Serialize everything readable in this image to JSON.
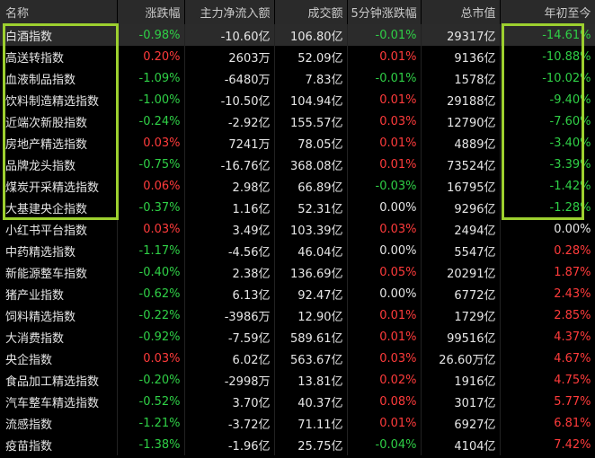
{
  "columns": [
    "名称",
    "涨跌幅",
    "主力净流入额",
    "成交额",
    "5分钟涨跌幅",
    "总市值",
    "年初至今"
  ],
  "rows": [
    {
      "name": "白酒指数",
      "chg": "-0.98%",
      "flow": "-10.60亿",
      "turnover": "106.80亿",
      "chg5": "-0.01%",
      "cap": "29317亿",
      "ytd": "-14.61%"
    },
    {
      "name": "高送转指数",
      "chg": "0.20%",
      "flow": "2603万",
      "turnover": "52.09亿",
      "chg5": "0.01%",
      "cap": "9136亿",
      "ytd": "-10.88%"
    },
    {
      "name": "血液制品指数",
      "chg": "-1.09%",
      "flow": "-6480万",
      "turnover": "7.83亿",
      "chg5": "-0.01%",
      "cap": "1578亿",
      "ytd": "-10.02%"
    },
    {
      "name": "饮料制造精选指数",
      "chg": "-1.00%",
      "flow": "-10.50亿",
      "turnover": "104.94亿",
      "chg5": "0.01%",
      "cap": "29188亿",
      "ytd": "-9.40%"
    },
    {
      "name": "近端次新股指数",
      "chg": "-0.24%",
      "flow": "-2.92亿",
      "turnover": "155.57亿",
      "chg5": "0.03%",
      "cap": "12790亿",
      "ytd": "-7.60%"
    },
    {
      "name": "房地产精选指数",
      "chg": "0.03%",
      "flow": "7241万",
      "turnover": "78.05亿",
      "chg5": "0.01%",
      "cap": "4889亿",
      "ytd": "-3.40%"
    },
    {
      "name": "品牌龙头指数",
      "chg": "-0.75%",
      "flow": "-16.76亿",
      "turnover": "368.08亿",
      "chg5": "0.01%",
      "cap": "73524亿",
      "ytd": "-3.39%"
    },
    {
      "name": "煤炭开采精选指数",
      "chg": "0.06%",
      "flow": "2.98亿",
      "turnover": "66.89亿",
      "chg5": "-0.03%",
      "cap": "16795亿",
      "ytd": "-1.42%"
    },
    {
      "name": "大基建央企指数",
      "chg": "-0.37%",
      "flow": "1.16亿",
      "turnover": "52.31亿",
      "chg5": "0.00%",
      "cap": "9296亿",
      "ytd": "-1.28%"
    },
    {
      "name": "小红书平台指数",
      "chg": "0.03%",
      "flow": "3.49亿",
      "turnover": "103.39亿",
      "chg5": "0.03%",
      "cap": "2494亿",
      "ytd": "0.00%"
    },
    {
      "name": "中药精选指数",
      "chg": "-1.17%",
      "flow": "-4.56亿",
      "turnover": "46.04亿",
      "chg5": "0.00%",
      "cap": "5547亿",
      "ytd": "0.28%"
    },
    {
      "name": "新能源整车指数",
      "chg": "-0.40%",
      "flow": "2.38亿",
      "turnover": "136.69亿",
      "chg5": "0.05%",
      "cap": "20291亿",
      "ytd": "1.87%"
    },
    {
      "name": "猪产业指数",
      "chg": "-0.62%",
      "flow": "6.13亿",
      "turnover": "92.47亿",
      "chg5": "0.00%",
      "cap": "6772亿",
      "ytd": "2.43%"
    },
    {
      "name": "饲料精选指数",
      "chg": "-0.22%",
      "flow": "-3986万",
      "turnover": "12.90亿",
      "chg5": "0.01%",
      "cap": "1729亿",
      "ytd": "2.85%"
    },
    {
      "name": "大消费指数",
      "chg": "-0.92%",
      "flow": "-7.59亿",
      "turnover": "589.61亿",
      "chg5": "0.01%",
      "cap": "99516亿",
      "ytd": "4.37%"
    },
    {
      "name": "央企指数",
      "chg": "0.03%",
      "flow": "6.02亿",
      "turnover": "563.67亿",
      "chg5": "0.03%",
      "cap": "26.60万亿",
      "ytd": "4.67%"
    },
    {
      "name": "食品加工精选指数",
      "chg": "-0.20%",
      "flow": "-2998万",
      "turnover": "13.81亿",
      "chg5": "0.02%",
      "cap": "1916亿",
      "ytd": "4.75%"
    },
    {
      "name": "汽车整车精选指数",
      "chg": "-0.52%",
      "flow": "3.70亿",
      "turnover": "40.37亿",
      "chg5": "0.08%",
      "cap": "3017亿",
      "ytd": "5.77%"
    },
    {
      "name": "流感指数",
      "chg": "-1.21%",
      "flow": "-3.72亿",
      "turnover": "71.11亿",
      "chg5": "0.01%",
      "cap": "6927亿",
      "ytd": "6.81%"
    },
    {
      "name": "疫苗指数",
      "chg": "-1.38%",
      "flow": "-1.96亿",
      "turnover": "25.75亿",
      "chg5": "-0.04%",
      "cap": "4104亿",
      "ytd": "7.42%"
    }
  ],
  "colors": {
    "up": "#ff3b3b",
    "down": "#2fcf46",
    "highlight": "#9dd02f"
  }
}
